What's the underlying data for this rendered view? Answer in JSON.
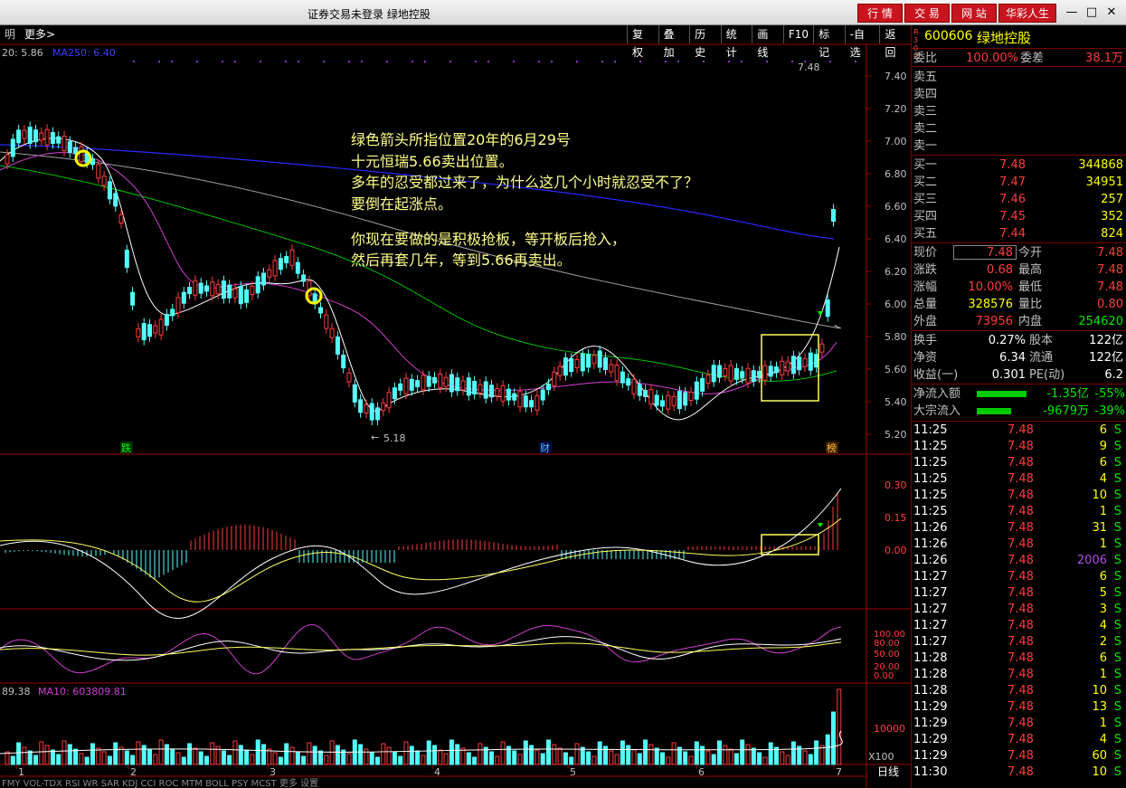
{
  "window": {
    "title": "证券交易未登录  绿地控股",
    "nav": [
      "行 情",
      "交 易",
      "网 站",
      "华彩人生"
    ]
  },
  "toolbar": {
    "left_label": "明",
    "more": "更多>",
    "items": [
      "复权",
      "叠加",
      "历史",
      "统计",
      "画线",
      "F10",
      "标记",
      "-自选",
      "返回"
    ]
  },
  "price_panel": {
    "ma_text_left": "20: 5.86",
    "ma250": "MA250: 6.40",
    "y_ticks": [
      "7.40",
      "7.20",
      "7.00",
      "6.80",
      "6.60",
      "6.40",
      "6.20",
      "6.00",
      "5.80",
      "5.60",
      "5.40",
      "5.20"
    ],
    "high_label": "7.48",
    "low_label": "5.18",
    "marks": [
      "跌",
      "财",
      "榜"
    ]
  },
  "annotation": {
    "line1": "绿色箭头所指位置20年的6月29号",
    "line2": "十元恒瑞5.66卖出位置。",
    "line3": "多年的忍受都过来了，为什么这几个小时就忍受不了？",
    "line4": "要倒在起涨点。",
    "line5": "你现在要做的是积极抢板，等开板后抢入，",
    "line6": "然后再套几年，等到5.66再卖出。"
  },
  "macd_panel": {
    "y_ticks": [
      "0.30",
      "0.15",
      "0.00"
    ]
  },
  "kdj_panel": {
    "y_ticks": [
      "100.00",
      "80.00",
      "50.00",
      "20.00",
      "0.00"
    ]
  },
  "volume_panel": {
    "label_left": "89.38",
    "ma10": "MA10: 603809.81",
    "y_tick": "10000",
    "unit": "X100"
  },
  "x_axis": {
    "ticks": [
      "1",
      "2",
      "3",
      "4",
      "5",
      "6",
      "7"
    ],
    "bottom_tabs": "FMY  VOL-TDX  RSI  WR  SAR  KDJ  CCI  ROC  MTM  BOLL  PSY  MCST  更多  设置",
    "right_label": "日线"
  },
  "stock": {
    "market_badge": "R300",
    "code": "600606",
    "name": "绿地控股"
  },
  "order_book": {
    "weibi_label": "委比",
    "weibi": "100.00%",
    "weicha_label": "委差",
    "weicha": "38.1万",
    "sells": [
      "卖五",
      "卖四",
      "卖三",
      "卖二",
      "卖一"
    ],
    "buys": [
      {
        "label": "买一",
        "price": "7.48",
        "vol": "344868"
      },
      {
        "label": "买二",
        "price": "7.47",
        "vol": "34951"
      },
      {
        "label": "买三",
        "price": "7.46",
        "vol": "257"
      },
      {
        "label": "买四",
        "price": "7.45",
        "vol": "352"
      },
      {
        "label": "买五",
        "price": "7.44",
        "vol": "824"
      }
    ]
  },
  "stats": [
    {
      "l1": "现价",
      "v1": "7.48",
      "l2": "今开",
      "v2": "7.48"
    },
    {
      "l1": "涨跌",
      "v1": "0.68",
      "l2": "最高",
      "v2": "7.48"
    },
    {
      "l1": "涨幅",
      "v1": "10.00%",
      "l2": "最低",
      "v2": "7.48"
    },
    {
      "l1": "总量",
      "v1": "328576",
      "l2": "量比",
      "v2": "0.80"
    },
    {
      "l1": "外盘",
      "v1": "73956",
      "l2": "内盘",
      "v2": "254620"
    }
  ],
  "stats2": [
    {
      "l1": "换手",
      "v1": "0.27%",
      "l2": "股本",
      "v2": "122亿"
    },
    {
      "l1": "净资",
      "v1": "6.34",
      "l2": "流通",
      "v2": "122亿"
    },
    {
      "l1": "收益(一)",
      "v1": "0.301",
      "l2": "PE(动)",
      "v2": "6.2"
    }
  ],
  "flows": [
    {
      "label": "净流入额",
      "value": "-1.35亿",
      "pct": "-55%"
    },
    {
      "label": "大宗流入",
      "value": "-9679万",
      "pct": "-39%"
    }
  ],
  "ticks": [
    {
      "t": "11:25",
      "p": "7.48",
      "v": "6",
      "s": "S"
    },
    {
      "t": "11:25",
      "p": "7.48",
      "v": "9",
      "s": "S"
    },
    {
      "t": "11:25",
      "p": "7.48",
      "v": "6",
      "s": "S"
    },
    {
      "t": "11:25",
      "p": "7.48",
      "v": "4",
      "s": "S"
    },
    {
      "t": "11:25",
      "p": "7.48",
      "v": "10",
      "s": "S"
    },
    {
      "t": "11:25",
      "p": "7.48",
      "v": "1",
      "s": "S"
    },
    {
      "t": "11:26",
      "p": "7.48",
      "v": "31",
      "s": "S"
    },
    {
      "t": "11:26",
      "p": "7.48",
      "v": "1",
      "s": "S"
    },
    {
      "t": "11:26",
      "p": "7.48",
      "v": "2006",
      "s": "S"
    },
    {
      "t": "11:27",
      "p": "7.48",
      "v": "6",
      "s": "S"
    },
    {
      "t": "11:27",
      "p": "7.48",
      "v": "5",
      "s": "S"
    },
    {
      "t": "11:27",
      "p": "7.48",
      "v": "3",
      "s": "S"
    },
    {
      "t": "11:27",
      "p": "7.48",
      "v": "4",
      "s": "S"
    },
    {
      "t": "11:27",
      "p": "7.48",
      "v": "2",
      "s": "S"
    },
    {
      "t": "11:28",
      "p": "7.48",
      "v": "6",
      "s": "S"
    },
    {
      "t": "11:28",
      "p": "7.48",
      "v": "1",
      "s": "S"
    },
    {
      "t": "11:28",
      "p": "7.48",
      "v": "10",
      "s": "S"
    },
    {
      "t": "11:29",
      "p": "7.48",
      "v": "13",
      "s": "S"
    },
    {
      "t": "11:29",
      "p": "7.48",
      "v": "1",
      "s": "S"
    },
    {
      "t": "11:29",
      "p": "7.48",
      "v": "4",
      "s": "S"
    },
    {
      "t": "11:29",
      "p": "7.48",
      "v": "60",
      "s": "S"
    },
    {
      "t": "11:30",
      "p": "7.48",
      "v": "10",
      "s": "S"
    }
  ],
  "colors": {
    "up": "#ff3c3c",
    "down": "#54ffff",
    "ma_blue": "#2828ff",
    "ma_green": "#00c000",
    "ma_white": "#ffffff",
    "ma_purple": "#d040d0",
    "highlight": "#ffff60"
  }
}
